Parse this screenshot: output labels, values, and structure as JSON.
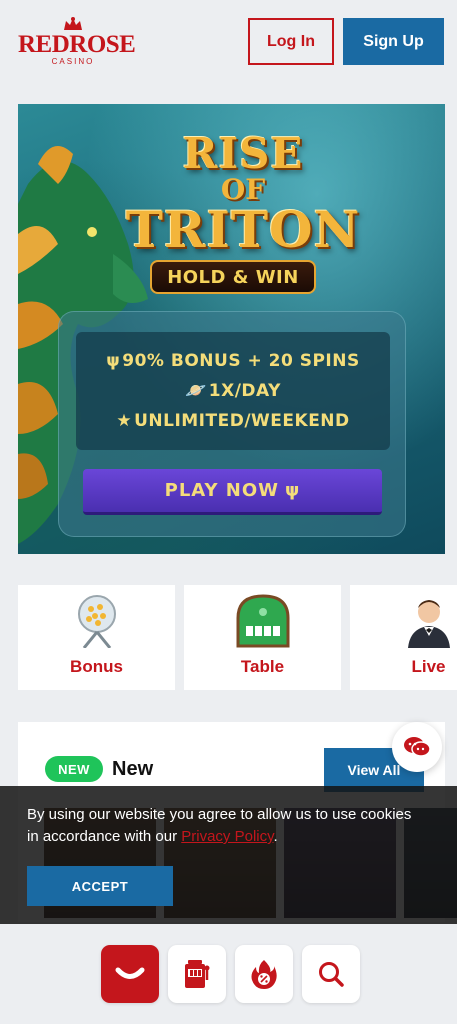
{
  "header": {
    "logo_text": "REDROSE",
    "logo_sub": "CASINO",
    "login_label": "Log In",
    "signup_label": "Sign Up"
  },
  "hero": {
    "title_line1": "RISE",
    "title_line2": "OF",
    "title_line3": "TRITON",
    "badge": "HOLD & WIN",
    "promo_lines": [
      {
        "icon": "trident-icon",
        "text": "90% BONUS + 20 SPINS"
      },
      {
        "icon": "planet-icon",
        "text": "1X/DAY"
      },
      {
        "icon": "star-icon",
        "text": "UNLIMITED/WEEKEND"
      }
    ],
    "play_label": "PLAY NOW"
  },
  "categories": [
    {
      "label": "Bonus",
      "icon": "lottery-ball-icon"
    },
    {
      "label": "Table",
      "icon": "card-table-icon"
    },
    {
      "label": "Live",
      "icon": "dealer-icon"
    }
  ],
  "new_section": {
    "badge": "NEW",
    "title": "New",
    "view_all": "View All"
  },
  "cookie": {
    "text_before": "By using our website you agree to allow us to use cookies in accordance with our ",
    "link_text": "Privacy Policy",
    "text_after": ".",
    "accept_label": "ACCEPT"
  },
  "bottom_nav": [
    {
      "icon": "home-smile-icon",
      "active": true
    },
    {
      "icon": "slot-machine-icon",
      "active": false
    },
    {
      "icon": "hot-offer-icon",
      "active": false
    },
    {
      "icon": "search-icon",
      "active": false
    }
  ],
  "colors": {
    "brand_red": "#c4161c",
    "brand_blue": "#1a6aa3",
    "new_green": "#1fc45a",
    "play_purple": "#5a3bc8",
    "promo_gold": "#f4dd7a"
  }
}
